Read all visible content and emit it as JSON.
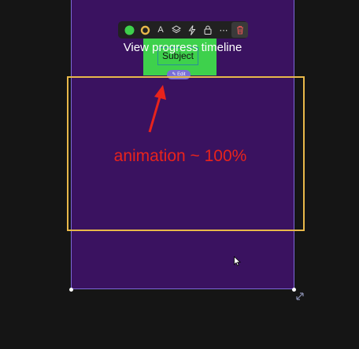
{
  "frame": {
    "heading": "View progress timeline",
    "background": "#3a1260",
    "border_color": "#7c6ad8"
  },
  "card": {
    "subject_label": "Subject",
    "edit_label": "Edit",
    "edit_icon": "pencil-icon",
    "card_color": "#3ed14c"
  },
  "toolbar": {
    "items": [
      {
        "name": "fill-color",
        "icon": "green-circle-icon",
        "color": "#3ed14c"
      },
      {
        "name": "stroke-color",
        "icon": "yellow-ring-icon",
        "color": "#e8b84a"
      },
      {
        "name": "text",
        "icon": "text-icon",
        "glyph": "A"
      },
      {
        "name": "layers",
        "icon": "layers-icon"
      },
      {
        "name": "interaction",
        "icon": "lightning-icon"
      },
      {
        "name": "lock",
        "icon": "lock-icon"
      },
      {
        "name": "more",
        "icon": "more-icon",
        "glyph": "⋯"
      },
      {
        "name": "delete",
        "icon": "trash-icon",
        "color": "#e05656"
      }
    ]
  },
  "annotation": {
    "text": "animation ~ 100%",
    "color": "#e8231c",
    "selection_color": "#e8b84a"
  },
  "cursor": {
    "icon": "pointer-cursor-icon"
  }
}
